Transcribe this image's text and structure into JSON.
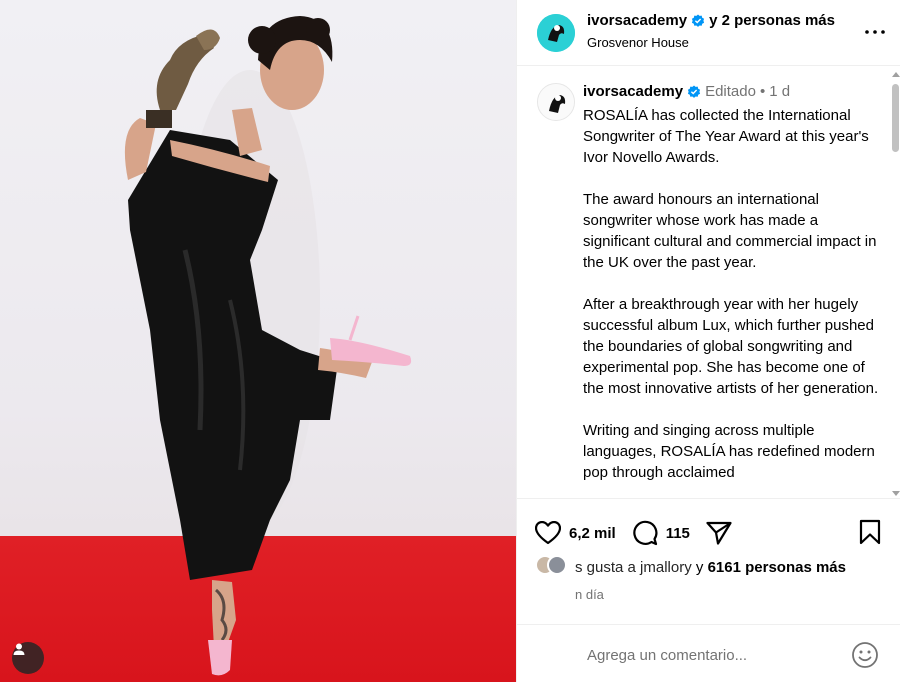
{
  "post": {
    "header": {
      "author": "ivorsacademy",
      "coauthors": "y 2 personas más",
      "location": "Grosvenor House"
    },
    "caption": {
      "author": "ivorsacademy",
      "edited": "Editado",
      "separator": "•",
      "time": "1 d",
      "paragraphs": [
        "ROSALÍA has collected the International Songwriter of The Year Award at this year's Ivor Novello Awards.",
        "The award honours an international songwriter whose work has made a significant cultural and commercial impact in the UK over the past year.",
        "After a breakthrough year with her hugely successful album Lux, which further pushed the boundaries of global songwriting and experimental pop. She has become one of the most innovative artists of her generation.",
        "Writing and singing across multiple languages, ROSALÍA has redefined modern pop through acclaimed"
      ]
    },
    "actions": {
      "likes": "6,2 mil",
      "comments": "115"
    },
    "likes_line": {
      "partial": "s gusta a jmallory",
      "joiner": " y ",
      "others": "6161 personas más"
    },
    "timestamp": "n día",
    "comment_placeholder": "Agrega un comentario..."
  },
  "colors": {
    "verified_blue": "#0095f6",
    "muted_text": "#737373",
    "red_carpet": "#e02026",
    "avatar_cyan": "#2bd0d5"
  },
  "icons": {
    "like": "heart-icon",
    "comment": "comment-icon",
    "share": "paper-plane-icon",
    "save": "bookmark-icon",
    "more": "more-dots-icon",
    "verified": "verified-badge-icon",
    "emoji": "emoji-icon",
    "user_tag": "user-icon"
  }
}
